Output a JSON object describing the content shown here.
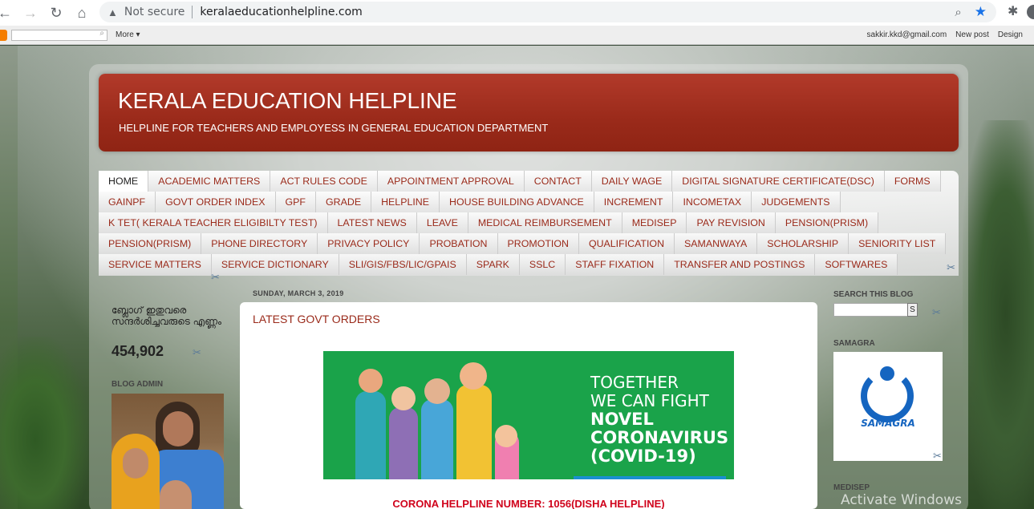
{
  "browser": {
    "not_secure": "Not secure",
    "url": "keralaeducationhelpline.com"
  },
  "navbar": {
    "more": "More ▾",
    "email": "sakkir.kkd@gmail.com",
    "new_post": "New post",
    "design": "Design"
  },
  "header": {
    "title": "KERALA EDUCATION HELPLINE",
    "description": "HELPLINE FOR TEACHERS AND EMPLOYESS IN GENERAL EDUCATION DEPARTMENT"
  },
  "tabs": {
    "row1": [
      "HOME",
      "ACADEMIC MATTERS",
      "ACT RULES CODE",
      "APPOINTMENT APPROVAL",
      "CONTACT",
      "DAILY WAGE",
      "DIGITAL SIGNATURE CERTIFICATE(DSC)",
      "FORMS"
    ],
    "row2": [
      "GAINPF",
      "GOVT ORDER INDEX",
      "GPF",
      "GRADE",
      "HELPLINE",
      "HOUSE BUILDING ADVANCE",
      "INCREMENT",
      "INCOMETAX",
      "JUDGEMENTS"
    ],
    "row3": [
      "K TET( KERALA TEACHER ELIGIBILTY TEST)",
      "LATEST NEWS",
      "LEAVE",
      "MEDICAL REIMBURSEMENT",
      "MEDISEP",
      "PAY REVISION",
      "PENSION(PRISM)"
    ],
    "row4": [
      "PENSION(PRISM)",
      "PHONE DIRECTORY",
      "PRIVACY POLICY",
      "PROBATION",
      "PROMOTION",
      "QUALIFICATION",
      "SAMANWAYA",
      "SCHOLARSHIP",
      "SENIORITY LIST"
    ],
    "row5": [
      "SERVICE MATTERS",
      "SERVICE DICTIONARY",
      "SLI/GIS/FBS/LIC/GPAIS",
      "SPARK",
      "SSLC",
      "STAFF FIXATION",
      "TRANSFER AND POSTINGS",
      "SOFTWARES"
    ]
  },
  "left": {
    "visitors_label": "ബ്ലോഗ് ഇതുവരെ സന്ദർശിച്ചവരുടെ എണ്ണം",
    "visitors_count": "454,902",
    "admin_label": "BLOG ADMIN"
  },
  "post": {
    "date": "SUNDAY, MARCH 3, 2019",
    "title": "LATEST GOVT ORDERS",
    "banner_line1": "TOGETHER",
    "banner_line2": "WE CAN FIGHT",
    "banner_line3": "NOVEL",
    "banner_line4": "CORONAVIRUS",
    "banner_line5": "(COVID-19)",
    "helpline": "CORONA HELPLINE NUMBER: 1056(DISHA HELPLINE)"
  },
  "right": {
    "search_label": "SEARCH THIS BLOG",
    "search_btn": "S",
    "samagra_label": "SAMAGRA",
    "samagra_logo_text": "SAMAGRA",
    "medisep_label": "MEDISEP"
  },
  "os": {
    "watermark": "Activate Windows"
  }
}
